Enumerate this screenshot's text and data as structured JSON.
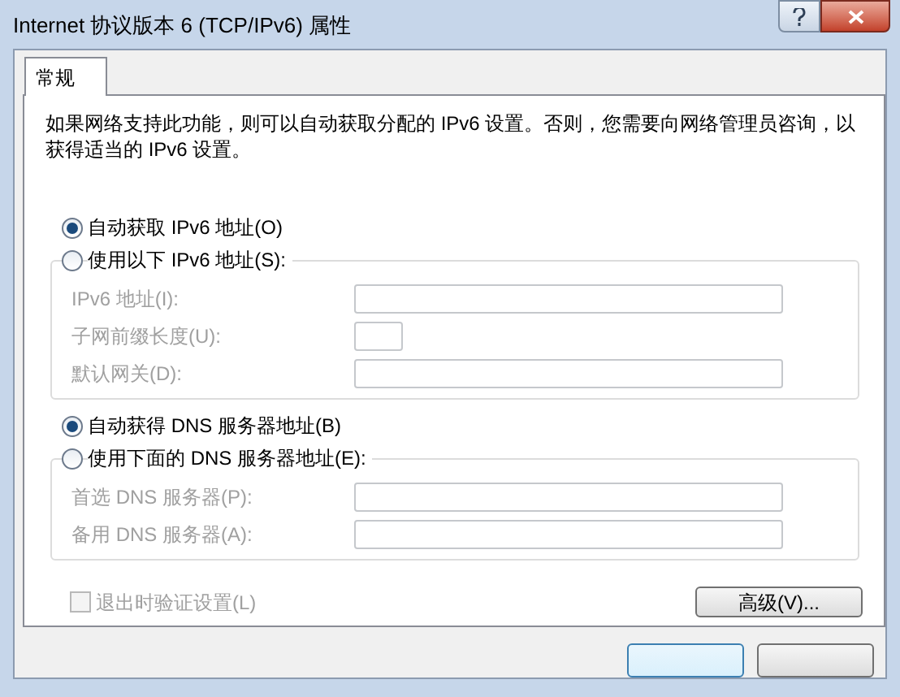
{
  "window": {
    "title": "Internet 协议版本 6 (TCP/IPv6) 属性"
  },
  "tabs": [
    {
      "label": "常规",
      "selected": true
    }
  ],
  "description": "如果网络支持此功能，则可以自动获取分配的 IPv6 设置。否则，您需要向网络管理员咨询，以获得适当的 IPv6 设置。",
  "ip_mode": [
    {
      "label": "自动获取 IPv6 地址(O)",
      "selected": true
    },
    {
      "label": "使用以下 IPv6 地址(S):",
      "selected": false
    }
  ],
  "ip_fields": [
    {
      "label": "IPv6 地址(I):",
      "kind": "wide",
      "disabled": true
    },
    {
      "label": "子网前缀长度(U):",
      "kind": "short",
      "disabled": true
    },
    {
      "label": "默认网关(D):",
      "kind": "wide",
      "disabled": true
    }
  ],
  "dns_mode": [
    {
      "label": "自动获得 DNS 服务器地址(B)",
      "selected": true
    },
    {
      "label": "使用下面的 DNS 服务器地址(E):",
      "selected": false
    }
  ],
  "dns_fields": [
    {
      "label": "首选 DNS 服务器(P):",
      "kind": "wide",
      "disabled": true
    },
    {
      "label": "备用 DNS 服务器(A):",
      "kind": "wide",
      "disabled": true
    }
  ],
  "validate": {
    "label": "退出时验证设置(L)",
    "checked": false,
    "disabled": true
  },
  "advanced_button": "高级(V)..."
}
